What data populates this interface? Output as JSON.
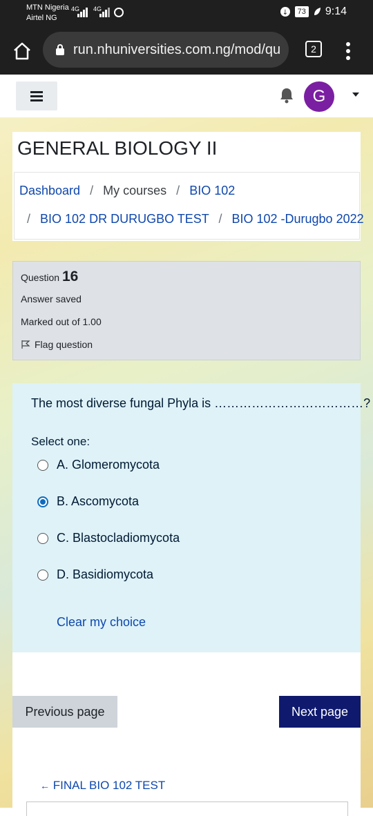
{
  "status_bar": {
    "carrier1": "MTN Nigeria",
    "carrier2": "Airtel NG",
    "sig1": "4G",
    "sig2": "4G",
    "battery": "73",
    "time": "9:14"
  },
  "browser": {
    "url": "run.nhuniversities.com.ng/mod/qu",
    "tab_count": "2"
  },
  "navbar": {
    "avatar_initial": "G"
  },
  "course": {
    "title": "GENERAL BIOLOGY II"
  },
  "breadcrumb": {
    "items": [
      "Dashboard",
      "My courses",
      "BIO 102",
      "BIO 102 DR DURUGBO TEST",
      "BIO 102 -Durugbo 2022"
    ],
    "separator": "/"
  },
  "question_info": {
    "label": "Question",
    "number": "16",
    "state": "Answer saved",
    "grade": "Marked out of 1.00",
    "flag": "Flag question"
  },
  "question": {
    "text": "The most diverse fungal Phyla is ………………………………?",
    "prompt": "Select one:",
    "options": [
      {
        "label": "A. Glomeromycota",
        "checked": false
      },
      {
        "label": "B. Ascomycota",
        "checked": true
      },
      {
        "label": "C. Blastocladiomycota",
        "checked": false
      },
      {
        "label": "D. Basidiomycota",
        "checked": false
      }
    ],
    "clear_label": "Clear my choice"
  },
  "navigation": {
    "prev_label": "Previous page",
    "next_label": "Next page",
    "back_link": "FINAL BIO 102 TEST"
  },
  "colors": {
    "link": "#0f47ad",
    "primary_button": "#0f1a6e",
    "question_bg": "#def2f8",
    "avatar": "#7b1fa2"
  }
}
